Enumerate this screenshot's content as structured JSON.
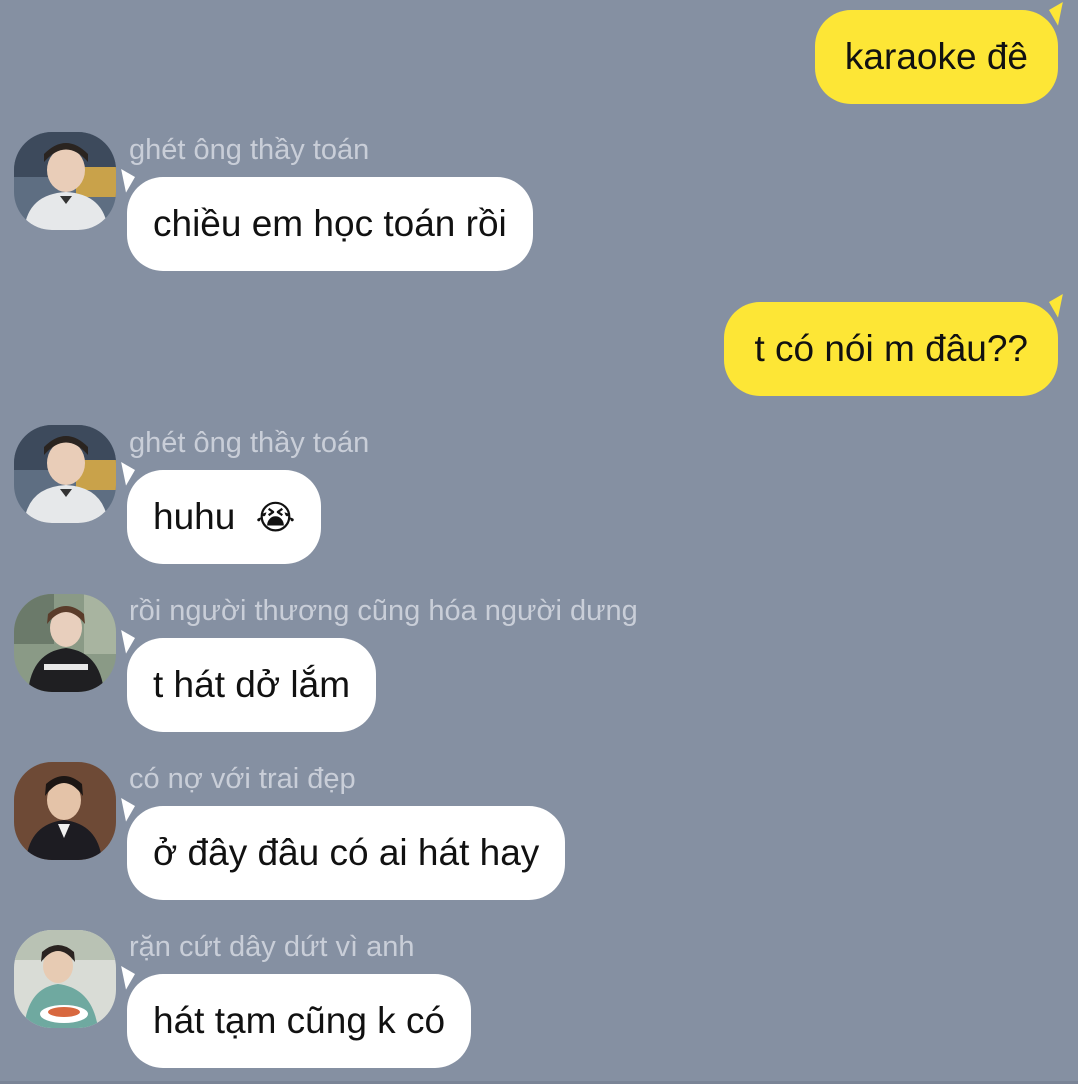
{
  "colors": {
    "background": "#8590a2",
    "sent_bubble": "#fde636",
    "received_bubble": "#ffffff",
    "sender_name": "#c9ced8"
  },
  "messages": [
    {
      "direction": "sent",
      "text": "karaoke đê"
    },
    {
      "direction": "received",
      "sender": "ghét ông thầy toán",
      "text": "chiều em học toán rồi"
    },
    {
      "direction": "sent",
      "text": "t có nói m đâu??"
    },
    {
      "direction": "received",
      "sender": "ghét ông thầy toán",
      "text": "huhu",
      "emoji": "😭"
    },
    {
      "direction": "received",
      "sender": "rồi người thương cũng hóa người dưng",
      "text": "t hát dở lắm"
    },
    {
      "direction": "received",
      "sender": "có nợ với trai đẹp",
      "text": "ở đây đâu có ai hát hay"
    },
    {
      "direction": "received",
      "sender": "rặn cứt dây dứt vì anh",
      "text": "hát tạm cũng k có"
    }
  ]
}
